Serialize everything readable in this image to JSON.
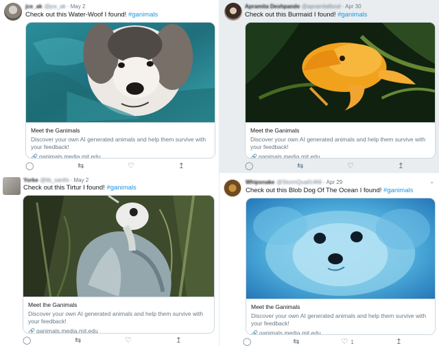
{
  "tweets": [
    {
      "author_name": "jce_ak",
      "handle": "@jce_ak",
      "date": "· May 2",
      "text_prefix": "Check out this Water-Woof I found! ",
      "hashtag": "#ganimals",
      "card_title": "Meet the Ganimals",
      "card_desc": "Discover your own AI generated animals and help them survive with your feedback!",
      "card_link": "ganimals.media.mit.edu",
      "like_count": ""
    },
    {
      "author_name": "Apramita Deshpande",
      "handle": "@apramitaflood",
      "date": "· Apr 30",
      "text_prefix": "Check out this Burmaid I found! ",
      "hashtag": "#ganimals",
      "card_title": "Meet the Ganimals",
      "card_desc": "Discover your own AI generated animals and help them survive with your feedback!",
      "card_link": "ganimals.media.mit.edu",
      "like_count": ""
    },
    {
      "author_name": "Yorke",
      "handle": "@lib_santhi",
      "date": "· May 2",
      "text_prefix": "Check out this Tirtur I found! ",
      "hashtag": "#ganimals",
      "card_title": "Meet the Ganimals",
      "card_desc": "Discover your own AI generated animals and help them survive with your feedback!",
      "card_link": "ganimals.media.mit.edu",
      "like_count": ""
    },
    {
      "author_name": "Whipsnake",
      "handle": "@StormQuail1466",
      "date": "· Apr 29",
      "text_prefix": "Check out this Blob Dog Of The Ocean I found! ",
      "hashtag": "#ganimals",
      "card_title": "Meet the Ganimals",
      "card_desc": "Discover your own AI generated animals and help them survive with your feedback!",
      "card_link": "ganimals.media.mit.edu",
      "like_count": "1"
    }
  ],
  "icons": {
    "reply": "reply-icon",
    "retweet": "retweet-icon",
    "like": "heart-icon",
    "share": "share-icon",
    "chevron": "chevron-down-icon",
    "link": "link-icon"
  },
  "colors": {
    "hashtag": "#1b95e0",
    "secondary_text": "#657786",
    "border": "#ccd6dd",
    "highlight_bg": "#e9edf0"
  }
}
